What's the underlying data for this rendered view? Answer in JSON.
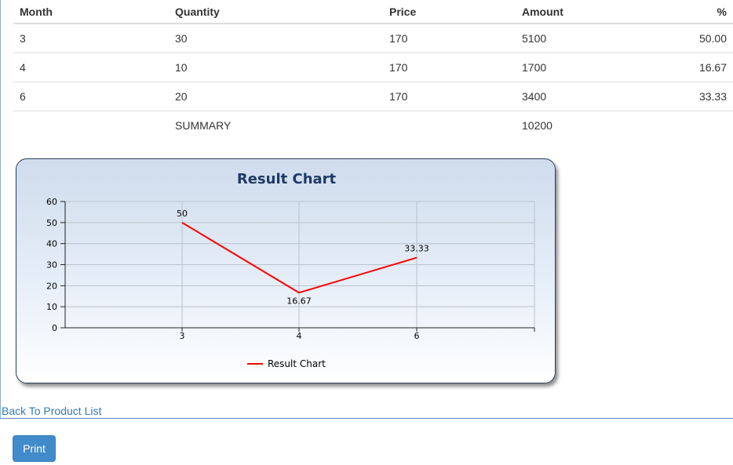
{
  "table": {
    "headers": {
      "month": "Month",
      "quantity": "Quantity",
      "price": "Price",
      "amount": "Amount",
      "percent": "%"
    },
    "rows": [
      {
        "month": "3",
        "quantity": "30",
        "price": "170",
        "amount": "5100",
        "percent": "50.00"
      },
      {
        "month": "4",
        "quantity": "10",
        "price": "170",
        "amount": "1700",
        "percent": "16.67"
      },
      {
        "month": "6",
        "quantity": "20",
        "price": "170",
        "amount": "3400",
        "percent": "33.33"
      }
    ],
    "summary": {
      "label": "SUMMARY",
      "amount": "10200"
    }
  },
  "chart_data": {
    "type": "line",
    "title": "Result Chart",
    "x": [
      "3",
      "4",
      "6"
    ],
    "series": [
      {
        "name": "Result Chart",
        "values": [
          50,
          16.67,
          33.33
        ],
        "labels": [
          "50",
          "16.67",
          "33.33"
        ],
        "color": "#ff0000"
      }
    ],
    "ylim": [
      0,
      60
    ],
    "yticks": [
      "0",
      "10",
      "20",
      "30",
      "40",
      "50",
      "60"
    ],
    "grid": true,
    "legend": "bottom"
  },
  "links": {
    "back": "Back To Product List"
  },
  "buttons": {
    "print": "Print"
  },
  "colors": {
    "link": "#337ab7",
    "button": "#428bca",
    "series": "#ff0000"
  }
}
